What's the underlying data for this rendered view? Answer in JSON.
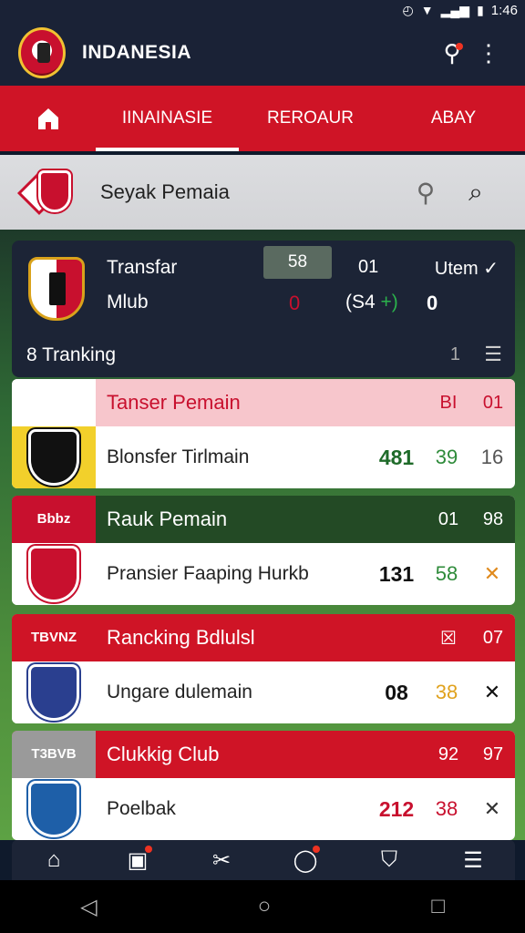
{
  "status": {
    "time": "1:46"
  },
  "app": {
    "title": "INDANESIA"
  },
  "tabs": [
    {
      "label": "IINAINASIE"
    },
    {
      "label": "REROAUR"
    },
    {
      "label": "ABAY"
    }
  ],
  "search": {
    "text": "Seyak Pemaia"
  },
  "summary": {
    "label1": "Transfar",
    "label2": "Mlub",
    "score_box": "58",
    "col2": "01",
    "item": "Utem ✓",
    "left_num": "0",
    "mid": "(S4",
    "mid_up": "+)",
    "right_num": "0",
    "ranking": "8 Tranking",
    "page": "1"
  },
  "cards": [
    {
      "tag": "",
      "title": "Tanser Pemain",
      "h1": "BI",
      "h2": "01",
      "name": "Blonsfer Tirlmain",
      "v1": "481",
      "v2": "39",
      "v3": "16",
      "head_bg": "#f7c6cc",
      "tag_bg": "#ffffff",
      "title_color": "#c8102e",
      "crest_bg": "#f2d02b",
      "v1_color": "#1f6b2a",
      "v2_color": "#2e8b3a",
      "v3_color": "#555555",
      "crest_color": "#111111"
    },
    {
      "tag": "Bbbz",
      "title": "Rauk Pemain",
      "h1": "01",
      "h2": "98",
      "name": "Pransier Faaping Hurkb",
      "v1": "131",
      "v2": "58",
      "v3": "✕",
      "head_bg": "#234a25",
      "tag_bg": "#c8102e",
      "title_color": "#ffffff",
      "crest_bg": "#ffffff",
      "v1_color": "#111111",
      "v2_color": "#2e8b3a",
      "v3_color": "#e08a1e",
      "crest_color": "#c8102e"
    },
    {
      "tag": "TBVNZ",
      "title": "Rancking Bdlulsl",
      "h1": "☒",
      "h2": "07",
      "name": "Ungare dulemain",
      "v1": "08",
      "v2": "38",
      "v3": "✕",
      "head_bg": "#cf1426",
      "tag_bg": "#cf1426",
      "title_color": "#ffffff",
      "crest_bg": "#ffffff",
      "v1_color": "#111111",
      "v2_color": "#e0a21e",
      "v3_color": "#111111",
      "crest_color": "#2a3f8f"
    },
    {
      "tag": "T3BVB",
      "title": "Clukkig Club",
      "h1": "92",
      "h2": "97",
      "name": "Poelbak",
      "v1": "212",
      "v2": "38",
      "v3": "✕",
      "head_bg": "#cf1426",
      "tag_bg": "#9a9a9a",
      "title_color": "#ffffff",
      "crest_bg": "#ffffff",
      "v1_color": "#c8102e",
      "v2_color": "#c8102e",
      "v3_color": "#333333",
      "crest_color": "#1e5fa8"
    }
  ],
  "icons": {
    "home": "home-icon",
    "search": "search-icon",
    "menu": "more-vert-icon"
  }
}
